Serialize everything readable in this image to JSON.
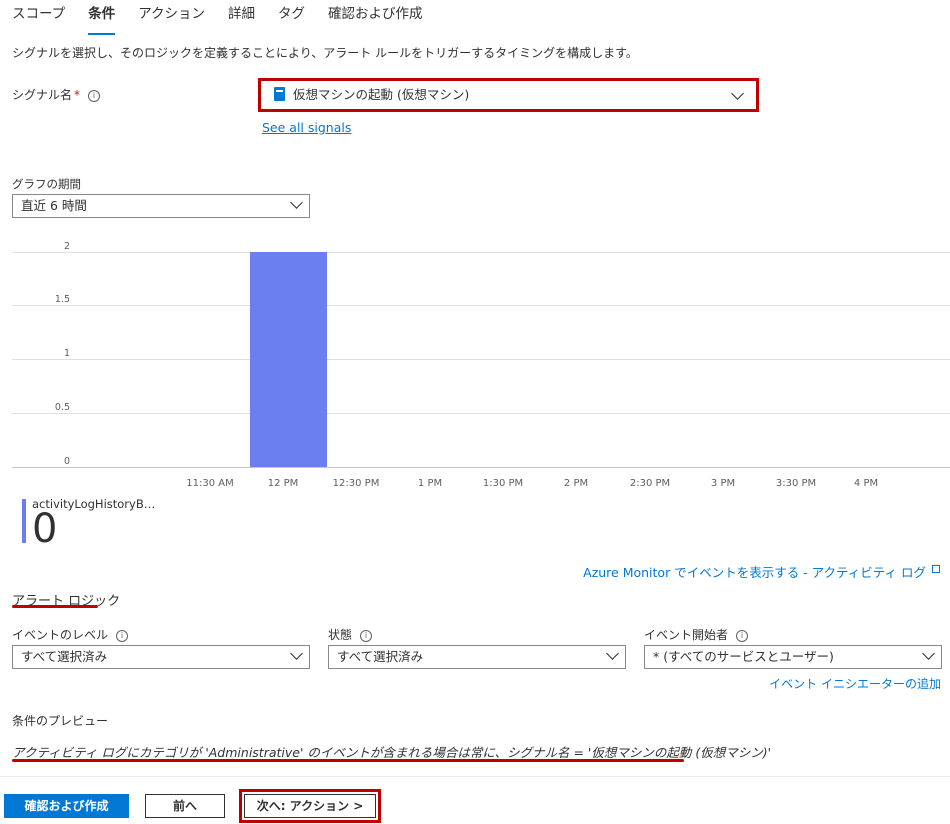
{
  "tabs": [
    {
      "label": "スコープ",
      "active": false
    },
    {
      "label": "条件",
      "active": true
    },
    {
      "label": "アクション",
      "active": false
    },
    {
      "label": "詳細",
      "active": false
    },
    {
      "label": "タグ",
      "active": false
    },
    {
      "label": "確認および作成",
      "active": false
    }
  ],
  "description": "シグナルを選択し、そのロジックを定義することにより、アラート ルールをトリガーするタイミングを構成します。",
  "signal": {
    "label": "シグナル名",
    "required_mark": "*",
    "value": "仮想マシンの起動 (仮想マシン)",
    "see_all_link": "See all signals"
  },
  "graph_period": {
    "label": "グラフの期間",
    "value": "直近 6 時間"
  },
  "chart_data": {
    "type": "bar",
    "x_ticks": [
      "11:30 AM",
      "12 PM",
      "12:30 PM",
      "1 PM",
      "1:30 PM",
      "2 PM",
      "2:30 PM",
      "3 PM",
      "3:30 PM",
      "4 PM"
    ],
    "y_ticks": [
      "2",
      "1.5",
      "1",
      "0.5",
      "0"
    ],
    "ylim": [
      0,
      2
    ],
    "series": [
      {
        "name": "activityLogHistoryB…",
        "color": "#6b7ff0",
        "bars": [
          {
            "x_start": "12 PM",
            "x_end": "12:15 PM",
            "value": 2
          }
        ]
      }
    ],
    "legend_value": "0"
  },
  "azure_monitor_link": "Azure Monitor でイベントを表示する - アクティビティ ログ",
  "alert_logic": {
    "heading": "アラート ロジック",
    "event_level": {
      "label": "イベントのレベル",
      "value": "すべて選択済み"
    },
    "status": {
      "label": "状態",
      "value": "すべて選択済み"
    },
    "initiator": {
      "label": "イベント開始者",
      "value": "* (すべてのサービスとユーザー)"
    },
    "add_initiator_link": "イベント イニシエーターの追加"
  },
  "preview": {
    "heading": "条件のプレビュー",
    "text": "アクティビティ ログにカテゴリが 'Administrative' のイベントが含まれる場合は常に、シグナル名 = '仮想マシンの起動 (仮想マシン)'"
  },
  "footer": {
    "review_create": "確認および作成",
    "previous": "前へ",
    "next": "次へ: アクション >"
  },
  "colors": {
    "accent": "#0078d4",
    "highlight": "#c00000",
    "bar": "#6b7ff0"
  }
}
